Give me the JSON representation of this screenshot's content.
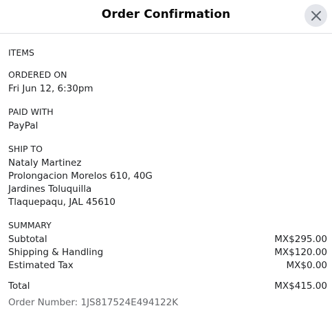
{
  "header": {
    "title": "Order Confirmation",
    "close_icon": "close-icon"
  },
  "items": {
    "label": "ITEMS"
  },
  "ordered_on": {
    "label": "ORDERED ON",
    "value": "Fri Jun 12, 6:30pm"
  },
  "paid_with": {
    "label": "PAID WITH",
    "value": "PayPal"
  },
  "ship_to": {
    "label": "SHIP TO",
    "lines": [
      "Nataly Martinez",
      "Prolongacion Morelos 610, 40G",
      "Jardines Toluquilla",
      "Tlaquepaqu, JAL 45610"
    ]
  },
  "summary": {
    "label": "SUMMARY",
    "rows": [
      {
        "label": "Subtotal",
        "value": "MX$295.00"
      },
      {
        "label": "Shipping & Handling",
        "value": "MX$120.00"
      },
      {
        "label": "Estimated Tax",
        "value": "MX$0.00"
      }
    ],
    "total": {
      "label": "Total",
      "value": "MX$415.00"
    }
  },
  "order_number": "Order Number: 1JS817524E494122K"
}
